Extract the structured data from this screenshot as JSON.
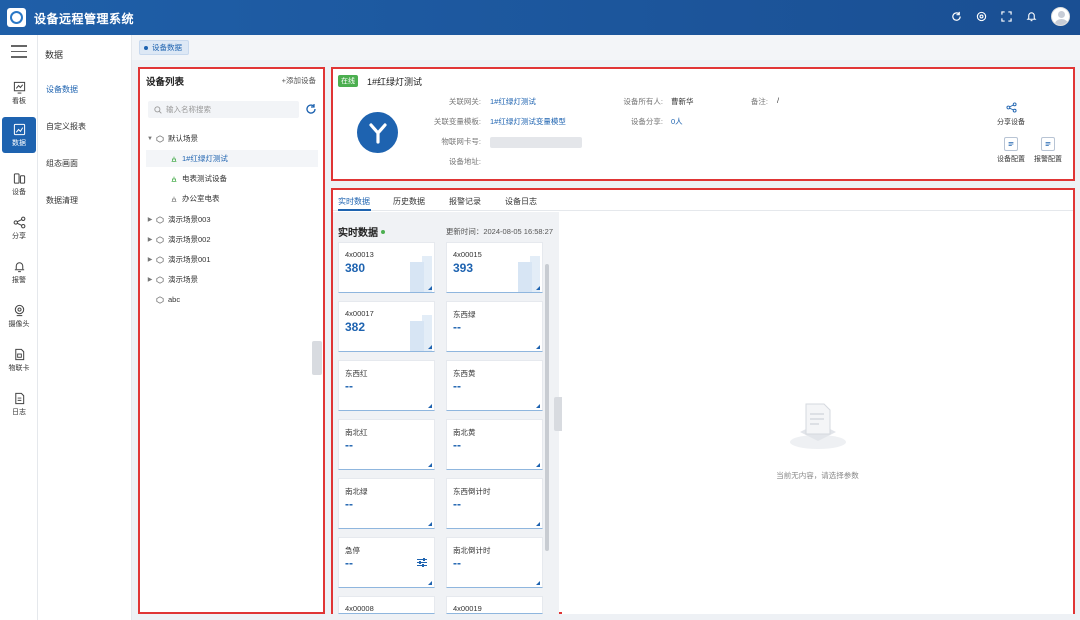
{
  "app": {
    "title": "设备远程管理系统"
  },
  "nav": {
    "items": [
      {
        "label": "看板",
        "icon": "chart-icon"
      },
      {
        "label": "数据",
        "icon": "data-icon",
        "active": true
      },
      {
        "label": "设备",
        "icon": "device-icon"
      },
      {
        "label": "分享",
        "icon": "share-icon"
      },
      {
        "label": "报警",
        "icon": "alarm-icon"
      },
      {
        "label": "摄像头",
        "icon": "camera-icon"
      },
      {
        "label": "物联卡",
        "icon": "sim-card-icon"
      },
      {
        "label": "日志",
        "icon": "log-icon"
      }
    ]
  },
  "submenu": {
    "title": "数据",
    "items": [
      "设备数据",
      "自定义报表",
      "组态画面",
      "数据清理"
    ]
  },
  "breadcrumb": {
    "tag": "设备数据"
  },
  "device_list": {
    "title": "设备列表",
    "add_label": "+添加设备",
    "search_placeholder": "输入名称搜索",
    "tree": [
      {
        "label": "默认场景",
        "type": "group",
        "expanded": true
      },
      {
        "label": "1#红绿灯测试",
        "type": "device",
        "selected": true
      },
      {
        "label": "电表测试设备",
        "type": "device"
      },
      {
        "label": "办公室电表",
        "type": "device"
      },
      {
        "label": "演示场景003",
        "type": "group"
      },
      {
        "label": "演示场景002",
        "type": "group"
      },
      {
        "label": "演示场景001",
        "type": "group"
      },
      {
        "label": "演示场景",
        "type": "group"
      },
      {
        "label": "abc",
        "type": "group"
      }
    ]
  },
  "device": {
    "status": "在线",
    "name": "1#红绿灯测试",
    "fields": {
      "gateway_label": "关联网关:",
      "gateway_value": "1#红绿灯测试",
      "template_label": "关联变量模板:",
      "template_value": "1#红绿灯测试变量模型",
      "sim_label": "物联网卡号:",
      "address_label": "设备地址:",
      "owner_label": "设备所有人:",
      "owner_value": "曹新华",
      "share_label": "设备分享:",
      "share_value": "0人",
      "remark_label": "备注:",
      "remark_value": "/"
    },
    "actions": {
      "share": "分享设备",
      "config": "设备配置",
      "alarm_config": "报警配置"
    }
  },
  "tabs": [
    "实时数据",
    "历史数据",
    "报警记录",
    "设备日志"
  ],
  "realtime": {
    "title": "实时数据",
    "update_label": "更新时间：2024-08-05 16:58:27",
    "cards": [
      {
        "name": "4x00013",
        "value": "380",
        "level": 0.38
      },
      {
        "name": "4x00015",
        "value": "393",
        "level": 0.39
      },
      {
        "name": "4x00017",
        "value": "382",
        "level": 0.38
      },
      {
        "name": "东西绿",
        "value": "--"
      },
      {
        "name": "东西红",
        "value": "--"
      },
      {
        "name": "东西黄",
        "value": "--"
      },
      {
        "name": "南北红",
        "value": "--"
      },
      {
        "name": "南北黄",
        "value": "--"
      },
      {
        "name": "南北绿",
        "value": "--"
      },
      {
        "name": "东西倒计时",
        "value": "--"
      },
      {
        "name": "急停",
        "value": "--",
        "adjustable": true
      },
      {
        "name": "南北倒计时",
        "value": "--"
      },
      {
        "name": "4x00008",
        "value": ""
      },
      {
        "name": "4x00019",
        "value": ""
      }
    ]
  },
  "empty_state": {
    "text": "当前无内容，请选择参数"
  }
}
